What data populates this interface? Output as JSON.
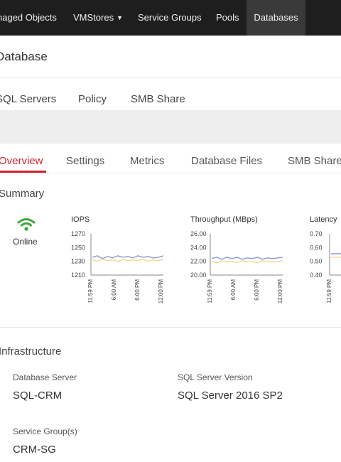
{
  "nav": {
    "items": [
      {
        "label": "naged Objects"
      },
      {
        "label": "VMStores",
        "dropdown_icon": "caret-down"
      },
      {
        "label": "Service Groups"
      },
      {
        "label": "Pools"
      },
      {
        "label": "Databases",
        "active": true
      }
    ]
  },
  "page": {
    "title": "Database"
  },
  "subtabs": [
    "SQL Servers",
    "Policy",
    "SMB Share"
  ],
  "tabs": {
    "items": [
      "Overview",
      "Settings",
      "Metrics",
      "Database Files",
      "SMB Share"
    ],
    "active": "Overview",
    "active_color": "#d0202e"
  },
  "summary": {
    "title": "Summary",
    "status": {
      "label": "Online",
      "icon": "wifi-signal",
      "color": "#3aa635"
    }
  },
  "chart_data": [
    {
      "type": "line",
      "title": "IOPS",
      "yticks": [
        "1270",
        "1250",
        "1230",
        "1210"
      ],
      "ylim": [
        1210,
        1270
      ],
      "xticks": [
        "11:59 PM",
        "6:00 AM",
        "6:00 PM",
        "12:00 PM"
      ],
      "series": [
        {
          "color": "#8e9ad0",
          "values": [
            1236,
            1238,
            1234,
            1237,
            1235,
            1238,
            1236,
            1237,
            1235,
            1238,
            1236,
            1237,
            1235,
            1236,
            1238
          ]
        },
        {
          "color": "#f1d98a",
          "values": [
            1232,
            1230,
            1233,
            1231,
            1232,
            1230,
            1233,
            1231,
            1232,
            1231,
            1233,
            1230,
            1232,
            1231,
            1233
          ]
        }
      ]
    },
    {
      "type": "line",
      "title": "Throughput (MBps)",
      "yticks": [
        "26.00",
        "24.00",
        "22.00",
        "20.00"
      ],
      "ylim": [
        20,
        26
      ],
      "xticks": [
        "11:59 PM",
        "6:00 AM",
        "6:00 PM",
        "12:00 PM"
      ],
      "series": [
        {
          "color": "#8e9ad0",
          "values": [
            22.4,
            22.6,
            22.3,
            22.6,
            22.4,
            22.6,
            22.3,
            22.5,
            22.4,
            22.6,
            22.3,
            22.5,
            22.4,
            22.5,
            22.6
          ]
        },
        {
          "color": "#f1d98a",
          "values": [
            22.0,
            21.8,
            22.1,
            21.9,
            22.0,
            21.8,
            22.1,
            21.9,
            22.0,
            21.8,
            22.1,
            21.9,
            22.0,
            21.9,
            22.1
          ]
        }
      ]
    },
    {
      "type": "line",
      "title": "Latency",
      "yticks": [
        "0.70",
        "0.60",
        "0.50",
        "0.40"
      ],
      "ylim": [
        0.4,
        0.7
      ],
      "xticks": [
        "11:59 PM"
      ],
      "series": [
        {
          "color": "#8e9ad0",
          "values": [
            0.555,
            0.555,
            0.555,
            0.555
          ]
        },
        {
          "color": "#f1d98a",
          "values": [
            0.53,
            0.53,
            0.53,
            0.53
          ]
        }
      ]
    }
  ],
  "infrastructure": {
    "title": "Infrastructure",
    "database_server_label": "Database Server",
    "database_server_value": "SQL-CRM",
    "sql_version_label": "SQL Server Version",
    "sql_version_value": "SQL Server 2016 SP2",
    "service_group_label": "Service Group(s)",
    "service_group_value": "CRM-SG"
  }
}
